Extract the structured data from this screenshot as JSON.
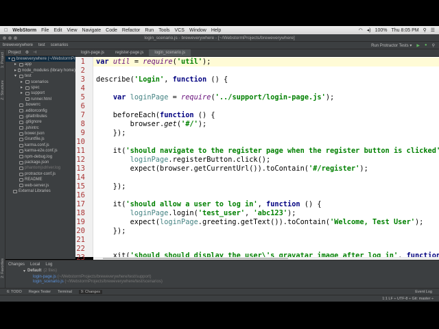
{
  "menubar": {
    "app": "WebStorm",
    "items": [
      "File",
      "Edit",
      "View",
      "Navigate",
      "Code",
      "Refactor",
      "Run",
      "Tools",
      "VCS",
      "Window",
      "Help"
    ],
    "battery": "100%",
    "clock": "Thu 8:05 PM"
  },
  "window_title": "login_scenario.js - breweverywhere - [~/WebstormProjects/breweverywhere]",
  "navbar": {
    "crumbs": [
      "breweverywhere",
      "test",
      "scenarios"
    ],
    "run_config": "Run Protractor Tests ▾"
  },
  "project": {
    "header": "Project",
    "left_tabs": [
      "1: Project",
      "Z: Structure",
      "2: Favorites"
    ],
    "tree": [
      {
        "label": "breweverywhere (~/WebstormPr",
        "depth": 0,
        "type": "folder",
        "open": true
      },
      {
        "label": "app",
        "depth": 1,
        "type": "folder"
      },
      {
        "label": "node_modules (library home)",
        "depth": 1,
        "type": "folder"
      },
      {
        "label": "test",
        "depth": 1,
        "type": "folder",
        "open": true
      },
      {
        "label": "scenarios",
        "depth": 2,
        "type": "folder"
      },
      {
        "label": "spec",
        "depth": 2,
        "type": "folder"
      },
      {
        "label": "support",
        "depth": 2,
        "type": "folder"
      },
      {
        "label": "runner.html",
        "depth": 2,
        "type": "file"
      },
      {
        "label": ".bowerrc",
        "depth": 1,
        "type": "file"
      },
      {
        "label": ".editorconfig",
        "depth": 1,
        "type": "file"
      },
      {
        "label": ".gitattributes",
        "depth": 1,
        "type": "file"
      },
      {
        "label": ".gitignore",
        "depth": 1,
        "type": "file"
      },
      {
        "label": ".jshintrc",
        "depth": 1,
        "type": "file"
      },
      {
        "label": "bower.json",
        "depth": 1,
        "type": "file"
      },
      {
        "label": "Gruntfile.js",
        "depth": 1,
        "type": "file"
      },
      {
        "label": "karma.conf.js",
        "depth": 1,
        "type": "file"
      },
      {
        "label": "karma-e2e.conf.js",
        "depth": 1,
        "type": "file"
      },
      {
        "label": "npm-debug.log",
        "depth": 1,
        "type": "file"
      },
      {
        "label": "package.json",
        "depth": 1,
        "type": "file"
      },
      {
        "label": "phantomjsdriver.log",
        "depth": 1,
        "type": "file",
        "dim": true
      },
      {
        "label": "protractor-conf.js",
        "depth": 1,
        "type": "file"
      },
      {
        "label": "README",
        "depth": 1,
        "type": "file"
      },
      {
        "label": "web-server.js",
        "depth": 1,
        "type": "file"
      },
      {
        "label": "External Libraries",
        "depth": 0,
        "type": "lib"
      }
    ]
  },
  "tabs": [
    {
      "label": "login-page.js"
    },
    {
      "label": "register-page.js"
    },
    {
      "label": "login_scenario.js",
      "active": true
    }
  ],
  "code": {
    "line_numbers": [
      "1",
      "2",
      "3",
      "4",
      "5",
      "6",
      "7",
      "8",
      "9",
      "10",
      "11",
      "12",
      "13",
      "14",
      "15",
      "16",
      "17",
      "18",
      "19",
      "20",
      "21",
      "22",
      "23"
    ]
  },
  "bottom": {
    "tabs": [
      "Changes",
      "Local",
      "Log"
    ],
    "changelist": "Default",
    "count": "(2 files)",
    "files": [
      {
        "name": "login-page.js",
        "path": "(~/WebstormProjects/breweverywhere/test/support)"
      },
      {
        "name": "login_scenario.js",
        "path": "(~/WebstormProjects/breweverywhere/test/scenarios)"
      }
    ]
  },
  "toolwindows": [
    "6: TODO",
    "Regex Tester",
    "Terminal",
    "9: Changes"
  ],
  "event_log": "Event Log",
  "status": "1:1   LF ÷   UTF-8 ÷   Git: master ÷"
}
